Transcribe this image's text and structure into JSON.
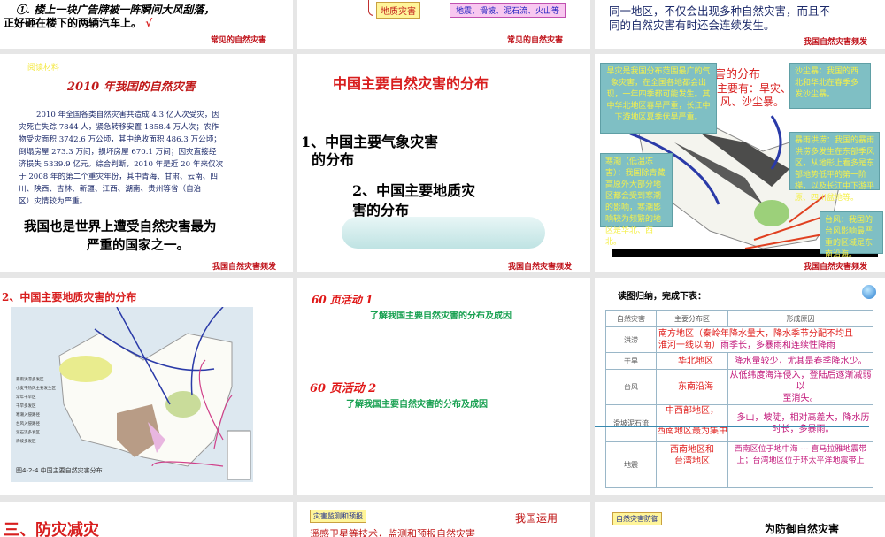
{
  "slides": {
    "s1": {
      "line1": "①. 楼上一块广告牌被一阵瞬间大风刮落，",
      "line2": "正好砸在楼下的两辆汽车上。",
      "check": "√",
      "footer": "常见的自然灾害"
    },
    "s2": {
      "label": "地质灾害",
      "items": "地震、滑坡、泥石流、火山等",
      "footer": "常见的自然灾害"
    },
    "s3": {
      "line1": "同一地区，不仅会出现多种自然灾害，而且不",
      "line2": "同的自然灾害有时还会连续发生。",
      "footer": "我国自然灾害频发"
    },
    "s4": {
      "tag": "阅读材料",
      "title": "2010 年我国的自然灾害",
      "para": [
        "2010 年全国各类自然灾害共造成 4.3 亿人次受灾，因",
        "灾死亡失踪 7844 人，紧急转移安置 1858.4 万人次；农作",
        "物受灾面积 3742.6 万公顷，其中绝收面积 486.3 万公顷；",
        "倒塌房屋 273.3 万间，损坏房屋 670.1 万间；因灾直接经",
        "济损失 5339.9 亿元。综合判断，2010 年是近 20 年来仅次",
        "于 2008 年的第二个重灾年份，其中青海、甘肃、云南、四",
        "川、陕西、吉林、新疆、江西、湖南、贵州等省（自治",
        "区）灾情较为严重。"
      ],
      "big1": "我国也是世界上遭受自然灾害最为",
      "big2": "严重的国家之一。",
      "footer": "我国自然灾害频发"
    },
    "s5": {
      "title": "中国主要自然灾害的分布",
      "item1a": "1、中国主要气象灾害",
      "item1b": "的分布",
      "item2a": "2、中国主要地质灾",
      "item2b": "害的分布",
      "footer": "我国自然灾害频发"
    },
    "s6": {
      "title_a": "害的分布",
      "title_b": "主要有：旱灾、",
      "title_c": "风、沙尘暴。",
      "callout_drought": "旱灾是我国分布范围最广的气象灾害，在全国各地都会出现，一年四季都可能发生。其中华北地区春旱严重，长江中下游地区夏季伏旱严重。",
      "callout_sand": "沙尘暴：我国的西北和华北在春季多发沙尘暴。",
      "callout_flood": "暴雨洪涝：我国的暴雨洪涝多发生在东部季风区，从地形上看多是东部地势低平的第一阶梯，以及长江中下游平原、四川盆地等。",
      "callout_cold": "寒潮（低温冻害）：我国除青藏高原外大部分地区都会受到寒潮的影响，寒潮影响较为频繁的地区是华北、西北。",
      "callout_typhoon": "台风：我国的台风影响最严重的区域是东南沿海。",
      "footer": "我国自然灾害频发"
    },
    "s7": {
      "title": "2、中国主要地质灾害的分布",
      "legend": [
        "暴雨洪涝多发区",
        "小麦干热风主要发生区",
        "常年干旱区",
        "干旱多发区",
        "寒潮入侵路径",
        "台风入侵路径",
        "泥石流多发区",
        "滑坡多发区"
      ],
      "caption": "图4-2-4 中国主要自然灾害分布"
    },
    "s8": {
      "act1": "60 页活动 1",
      "desc1": "了解我国主要自然灾害的分布及成因",
      "act2": "60 页活动 2",
      "desc2": "了解我国主要自然灾害的分布及成因"
    },
    "s9": {
      "title": "读图归纳，完成下表：",
      "headers": [
        "自然灾害",
        "主要分布区",
        "形成原因"
      ],
      "rows": [
        {
          "name": "洪涝",
          "area": "南方地区（秦岭",
          "area2": "淮河一线以南）",
          "cause": "年降水量大，降水季节分配不均且",
          "cause2": "雨季长，多暴雨和连续性降雨"
        },
        {
          "name": "干旱",
          "area": "华北地区",
          "cause": "降水量较少，尤其是春季降水少。"
        },
        {
          "name": "台风",
          "area": "东南沿海",
          "cause": "从低纬度海洋侵入，登陆后逐渐减弱以",
          "cause2": "至消失。"
        },
        {
          "name": "滑坡泥石流",
          "area": "中西部地区，",
          "area2": "西南地区最为集中",
          "cause": "多山，坡陡，相对高差大，降水历",
          "cause2": "时长，多暴雨。"
        },
        {
          "name": "地震",
          "area": "西南地区和",
          "area2": "台湾地区",
          "cause": "西南区位于地中海 --- 喜马拉雅地震带",
          "cause2": "上；台湾地区位于环太平洋地震带上"
        }
      ]
    },
    "s10": {
      "title": "三、防灾减灾"
    },
    "s11": {
      "tag": "灾害监测和预报",
      "text": "我国运用",
      "line2": "遥感卫星等技术，监测和预报自然灾害"
    },
    "s12": {
      "tag": "自然灾害防御",
      "text": "为防御自然灾害"
    }
  }
}
